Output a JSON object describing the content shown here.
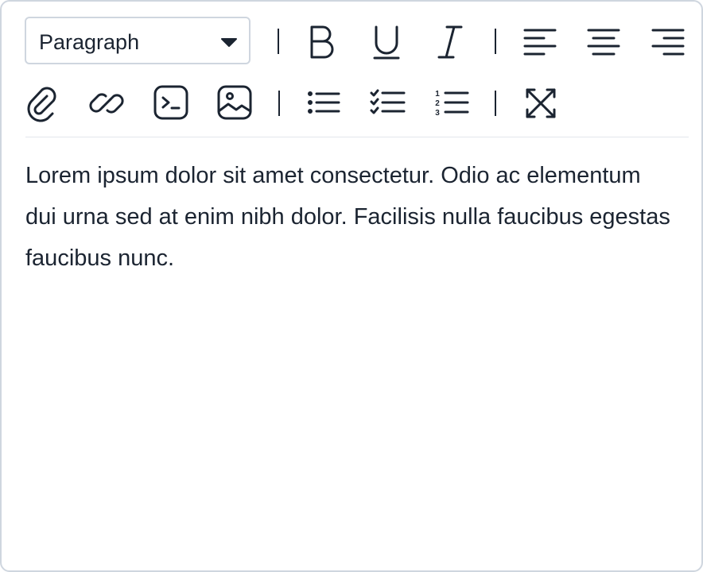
{
  "toolbar": {
    "block_format": {
      "selected": "Paragraph"
    },
    "row1_tools": [
      {
        "name": "bold",
        "icon": "bold-icon"
      },
      {
        "name": "underline",
        "icon": "underline-icon"
      },
      {
        "name": "italic",
        "icon": "italic-icon"
      },
      {
        "name": "align-left",
        "icon": "align-left-icon"
      },
      {
        "name": "align-center",
        "icon": "align-center-icon"
      },
      {
        "name": "align-right",
        "icon": "align-right-icon"
      }
    ],
    "row2_tools": [
      {
        "name": "attachment",
        "icon": "paperclip-icon"
      },
      {
        "name": "link",
        "icon": "link-icon"
      },
      {
        "name": "code-block",
        "icon": "terminal-icon"
      },
      {
        "name": "image",
        "icon": "image-icon"
      },
      {
        "name": "bullet-list",
        "icon": "bullet-list-icon"
      },
      {
        "name": "checklist",
        "icon": "checklist-icon"
      },
      {
        "name": "numbered-list",
        "icon": "numbered-list-icon"
      },
      {
        "name": "fullscreen",
        "icon": "fullscreen-icon"
      }
    ],
    "numbered_list_digits": [
      "1",
      "2",
      "3"
    ]
  },
  "editor": {
    "content": "Lorem ipsum dolor sit amet consectetur. Odio ac elementum dui urna sed at enim nibh dolor. Facilisis nulla faucibus egestas faucibus nunc."
  },
  "colors": {
    "text": "#1b2431",
    "border": "#cfd6df",
    "divider": "#e3e7ec",
    "background": "#ffffff"
  }
}
